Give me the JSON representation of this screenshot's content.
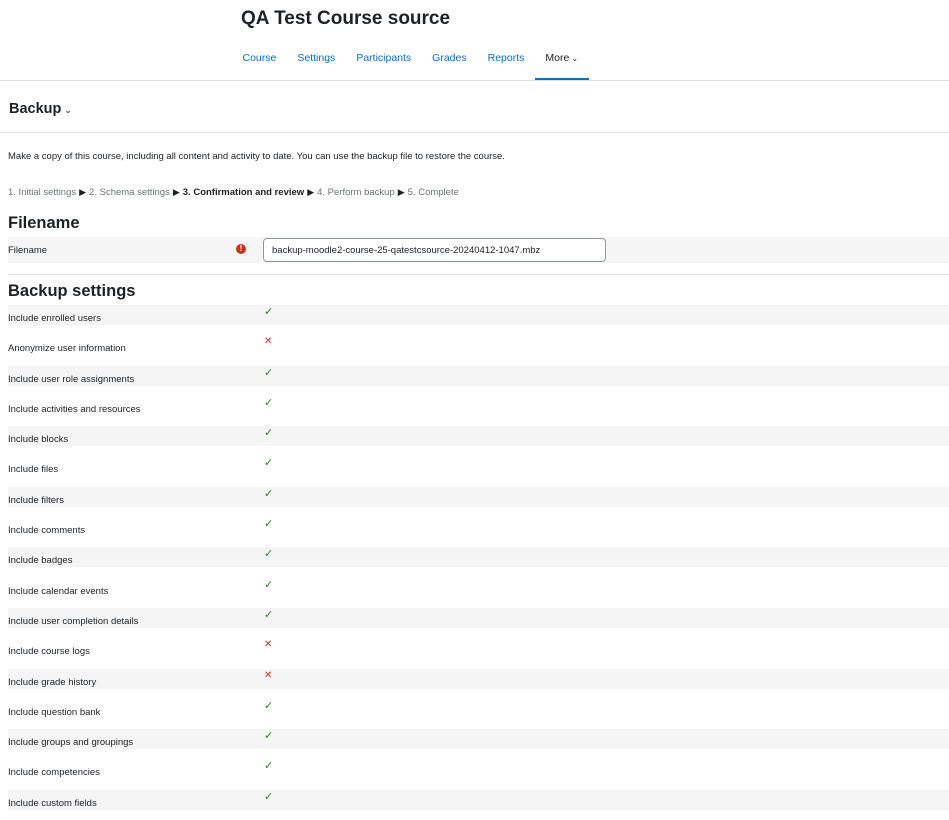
{
  "course": {
    "title": "QA Test Course source",
    "nav": [
      "Course",
      "Settings",
      "Participants",
      "Grades",
      "Reports"
    ],
    "more_label": "More"
  },
  "backup_menu": {
    "label": "Backup"
  },
  "description": "Make a copy of this course, including all content and activity to date. You can use the backup file to restore the course.",
  "steps": {
    "items": [
      "1. Initial settings",
      "2. Schema settings",
      "3. Confirmation and review",
      "4. Perform backup",
      "5. Complete"
    ],
    "current": 2,
    "separator": "▶"
  },
  "filename_section": {
    "heading": "Filename",
    "label": "Filename",
    "value": "backup-moodle2-course-25-qatestcsource-20240412-1047.mbz",
    "required_icon": "exclamation-circle-icon"
  },
  "settings_section": {
    "heading": "Backup settings",
    "items": [
      {
        "label": "Include enrolled users",
        "enabled": true
      },
      {
        "label": "Anonymize user information",
        "enabled": false
      },
      {
        "label": "Include user role assignments",
        "enabled": true
      },
      {
        "label": "Include activities and resources",
        "enabled": true
      },
      {
        "label": "Include blocks",
        "enabled": true
      },
      {
        "label": "Include files",
        "enabled": true
      },
      {
        "label": "Include filters",
        "enabled": true
      },
      {
        "label": "Include comments",
        "enabled": true
      },
      {
        "label": "Include badges",
        "enabled": true
      },
      {
        "label": "Include calendar events",
        "enabled": true
      },
      {
        "label": "Include user completion details",
        "enabled": true
      },
      {
        "label": "Include course logs",
        "enabled": false
      },
      {
        "label": "Include grade history",
        "enabled": false
      },
      {
        "label": "Include question bank",
        "enabled": true
      },
      {
        "label": "Include groups and groupings",
        "enabled": true
      },
      {
        "label": "Include competencies",
        "enabled": true
      },
      {
        "label": "Include custom fields",
        "enabled": true
      }
    ],
    "icons": {
      "yes": "check-icon",
      "no": "cross-icon"
    }
  },
  "colors": {
    "link": "#0f6cbf",
    "success": "#357a32",
    "danger": "#ca3120"
  }
}
